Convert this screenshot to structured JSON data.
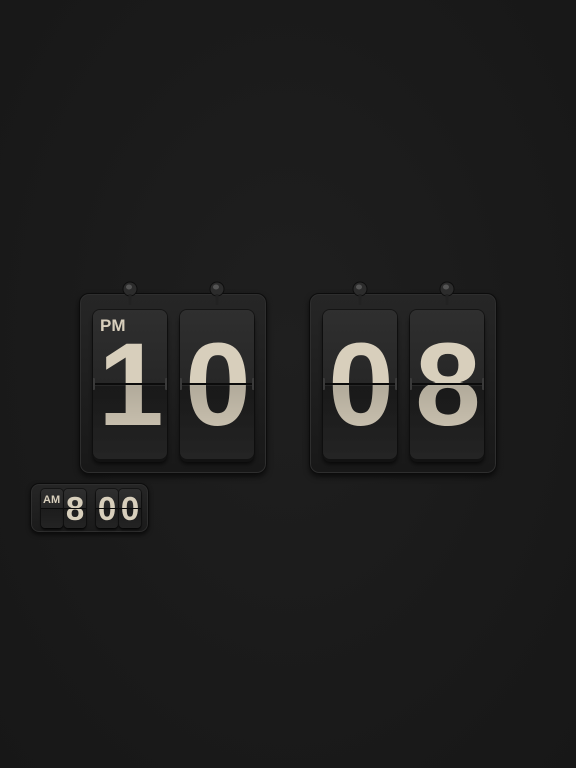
{
  "clock": {
    "meridiem": "PM",
    "hour_tens": "1",
    "hour_ones": "0",
    "minute_tens": "0",
    "minute_ones": "8"
  },
  "alarm": {
    "meridiem": "AM",
    "hour_tens": "",
    "hour_ones": "8",
    "minute_tens": "0",
    "minute_ones": "0"
  },
  "colors": {
    "background": "#1b1b1b",
    "digit": "#d8cfbc",
    "card": "#2a2a2a"
  },
  "icons": [
    "pin-icon",
    "pin-icon",
    "pin-icon",
    "pin-icon"
  ]
}
